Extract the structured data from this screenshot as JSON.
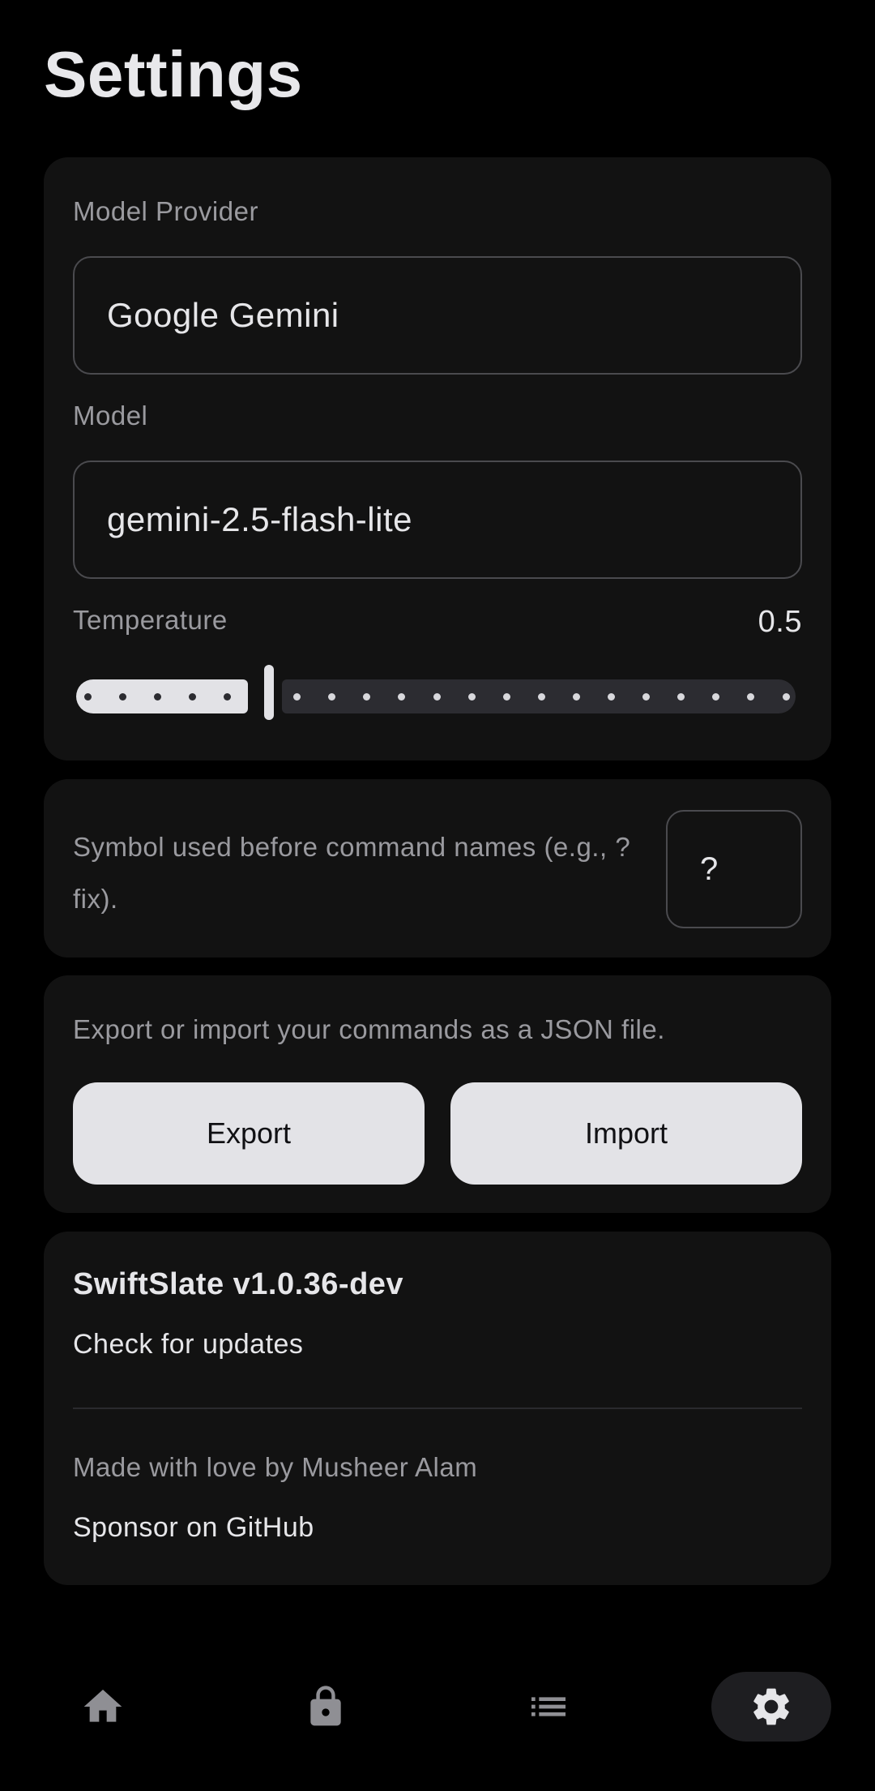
{
  "page": {
    "title": "Settings"
  },
  "model_settings": {
    "provider_label": "Model Provider",
    "provider_value": "Google Gemini",
    "model_label": "Model",
    "model_value": "gemini-2.5-flash-lite",
    "temperature_label": "Temperature",
    "temperature_value": "0.5",
    "temperature_min": 0,
    "temperature_max": 2,
    "temperature_fraction": 0.25
  },
  "command_symbol": {
    "description": "Symbol used before command names (e.g., ?fix).",
    "value": "?"
  },
  "export_import": {
    "description": "Export or import your commands as a JSON file.",
    "export_label": "Export",
    "import_label": "Import"
  },
  "about": {
    "version": "SwiftSlate v1.0.36-dev",
    "check_updates": "Check for updates",
    "made_with": "Made with love by Musheer Alam",
    "sponsor": "Sponsor on GitHub"
  },
  "nav": {
    "items": [
      {
        "icon": "home-icon"
      },
      {
        "icon": "lock-icon"
      },
      {
        "icon": "list-icon"
      },
      {
        "icon": "gear-icon",
        "active": true
      }
    ]
  },
  "colors": {
    "background": "#000000",
    "card": "#121212",
    "accent": "#e3e3e7",
    "muted_text": "#9a9a9f"
  }
}
